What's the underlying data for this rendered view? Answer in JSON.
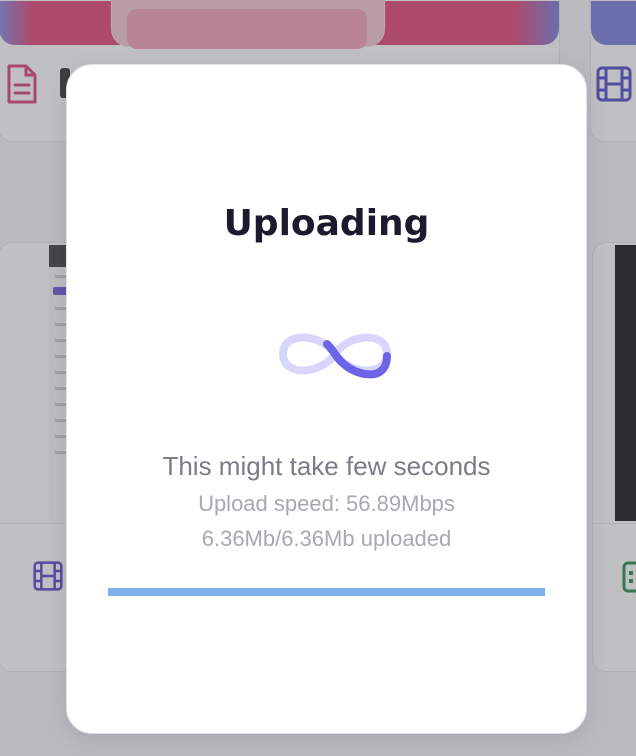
{
  "modal": {
    "title": "Uploading",
    "message": "This might take few seconds",
    "speed_text": "Upload speed: 56.89Mbps",
    "size_text": "6.36Mb/6.36Mb uploaded",
    "progress_fraction": 1.0,
    "spinner_icon": "infinity-loader-icon"
  },
  "colors": {
    "accent": "#6c63e6",
    "accent_light": "#d9d6fb",
    "progress": "#7fb1ec",
    "title": "#1c1b2e",
    "text_muted": "#7d7b84",
    "text_light": "#a9a8ae"
  },
  "background": {
    "icons": [
      "document-icon",
      "film-icon",
      "film-icon",
      "spreadsheet-icon"
    ]
  }
}
